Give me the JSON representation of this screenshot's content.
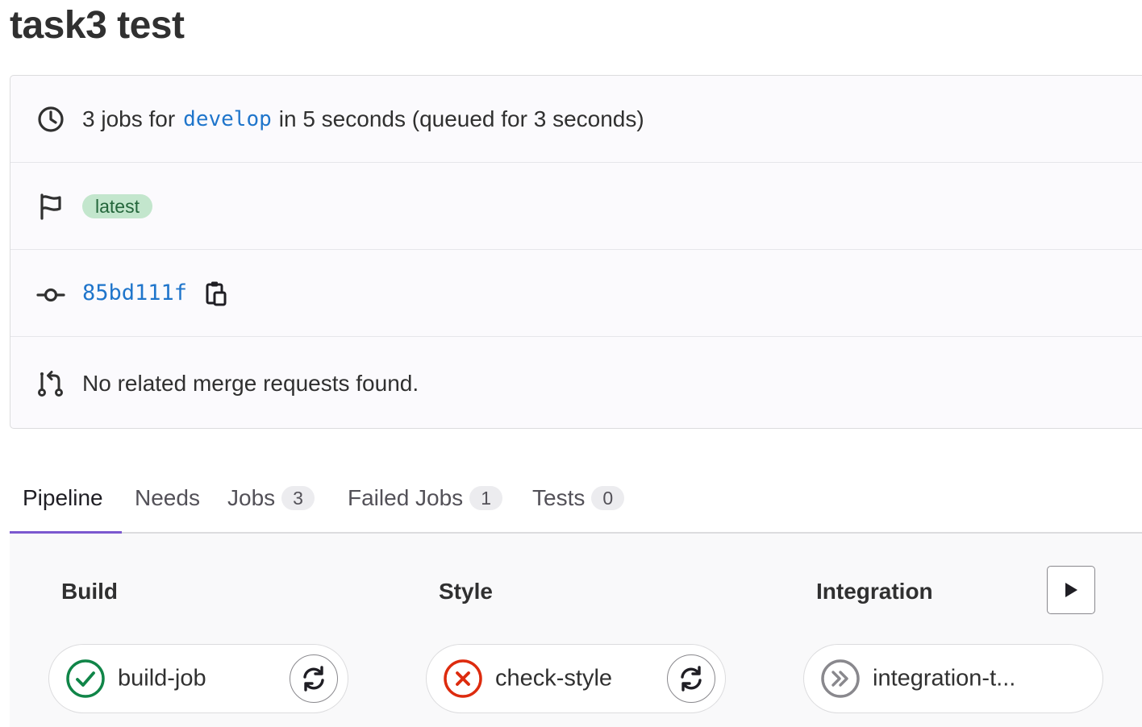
{
  "page": {
    "title": "task3 test"
  },
  "info": {
    "jobs_summary": {
      "prefix": "3 jobs for",
      "ref": "develop",
      "suffix": "in 5 seconds (queued for 3 seconds)"
    },
    "badge": "latest",
    "commit_sha": "85bd111f",
    "merge_requests": "No related merge requests found."
  },
  "tabs": [
    {
      "label": "Pipeline",
      "active": true
    },
    {
      "label": "Needs"
    },
    {
      "label": "Jobs",
      "count": "3"
    },
    {
      "label": "Failed Jobs",
      "count": "1"
    },
    {
      "label": "Tests",
      "count": "0"
    }
  ],
  "stages": [
    {
      "title": "Build",
      "job": {
        "name": "build-job",
        "status": "success"
      }
    },
    {
      "title": "Style",
      "job": {
        "name": "check-style",
        "status": "failed"
      }
    },
    {
      "title": "Integration",
      "job": {
        "name": "integration-t...",
        "status": "skipped"
      }
    }
  ],
  "colors": {
    "link": "#1f75cb",
    "success": "#108548",
    "failed": "#dd2b0e",
    "skipped": "#89888d",
    "tab_active_underline": "#7b58cf",
    "badge_bg": "#c3e6cd"
  },
  "icons": [
    "clock-icon",
    "flag-icon",
    "commit-icon",
    "copy-icon",
    "merge-request-icon",
    "play-icon",
    "retry-icon",
    "status-success-icon",
    "status-failed-icon",
    "status-skipped-icon"
  ]
}
